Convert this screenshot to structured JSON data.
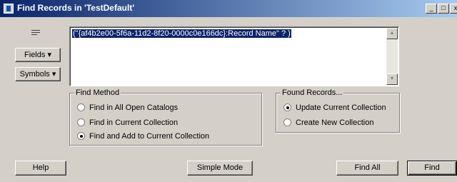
{
  "window": {
    "title": "Find Records in 'TestDefault'",
    "buttons": {
      "minimize": "_",
      "maximize": "□",
      "close": "x"
    }
  },
  "left": {
    "fields_label": "Fields",
    "symbols_label": "Symbols"
  },
  "query": {
    "text": "(\"{af4b2e00-5f6a-11d2-8f20-0000c0e166dc}:Record Name\" ? )"
  },
  "find_method": {
    "legend": "Find Method",
    "options": [
      {
        "label": "Find in All Open Catalogs",
        "selected": false
      },
      {
        "label": "Find in Current Collection",
        "selected": false
      },
      {
        "label": "Find and Add to Current Collection",
        "selected": true
      }
    ]
  },
  "found_records": {
    "legend": "Found Records...",
    "options": [
      {
        "label": "Update Current Collection",
        "selected": true
      },
      {
        "label": "Create New Collection",
        "selected": false
      }
    ]
  },
  "bottom": {
    "help": "Help",
    "simple_mode": "Simple Mode",
    "find_all": "Find All",
    "find": "Find"
  },
  "colors": {
    "titlebar": "#0a246a",
    "face": "#d4d0c8",
    "selection": "#0a246a"
  }
}
